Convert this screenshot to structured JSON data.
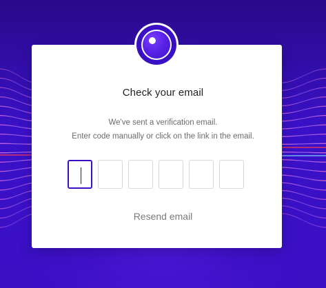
{
  "dialog": {
    "title": "Check your email",
    "description_line1": "We've sent a verification email.",
    "description_line2": "Enter code manually or click on the link in the email.",
    "resend_label": "Resend email"
  },
  "code_input": {
    "digits": [
      "",
      "",
      "",
      "",
      "",
      ""
    ],
    "active_index": 0
  },
  "logo": {
    "icon": "brand-orb-icon"
  },
  "colors": {
    "background_top": "#2a0a8a",
    "background_bottom": "#3b10c5",
    "accent": "#3b10c5",
    "card": "#ffffff",
    "title_text": "#1f1f1f",
    "body_text": "#6b6b6b",
    "link_text": "#7a7a7a",
    "input_border": "#d7d7de"
  }
}
